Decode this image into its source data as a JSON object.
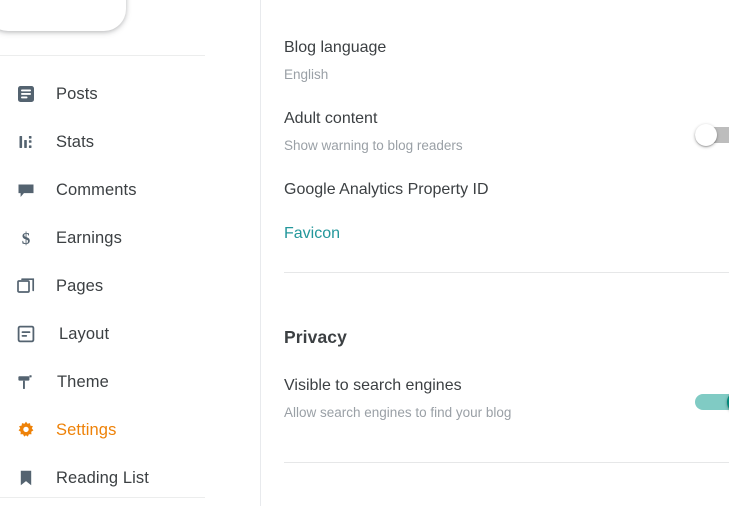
{
  "colors": {
    "accent_orange": "#ee8208",
    "link_teal": "#23979b",
    "toggle_on_track": "#80cbc4",
    "toggle_on_knob": "#00897b",
    "toggle_off_track": "#bdbdbd",
    "icon_slate": "#546370",
    "text_primary": "#3c4043",
    "text_secondary": "#9aa0a6"
  },
  "sidebar": {
    "items": [
      {
        "label": "Posts",
        "icon": "posts-icon",
        "active": false
      },
      {
        "label": "Stats",
        "icon": "stats-icon",
        "active": false
      },
      {
        "label": "Comments",
        "icon": "comments-icon",
        "active": false
      },
      {
        "label": "Earnings",
        "icon": "earnings-icon",
        "active": false
      },
      {
        "label": "Pages",
        "icon": "pages-icon",
        "active": false
      },
      {
        "label": "Layout",
        "icon": "layout-icon",
        "active": false
      },
      {
        "label": "Theme",
        "icon": "theme-icon",
        "active": false
      },
      {
        "label": "Settings",
        "icon": "gear-icon",
        "active": true
      },
      {
        "label": "Reading List",
        "icon": "bookmark-icon",
        "active": false
      }
    ]
  },
  "content": {
    "blog_language": {
      "title": "Blog language",
      "value": "English"
    },
    "adult_content": {
      "title": "Adult content",
      "subtitle": "Show warning to blog readers",
      "toggle_state": "off"
    },
    "google_analytics": {
      "title": "Google Analytics Property ID"
    },
    "favicon": {
      "link_label": "Favicon"
    },
    "privacy": {
      "heading": "Privacy",
      "visible_to_search_engines": {
        "title": "Visible to search engines",
        "subtitle": "Allow search engines to find your blog",
        "toggle_state": "on"
      }
    }
  }
}
